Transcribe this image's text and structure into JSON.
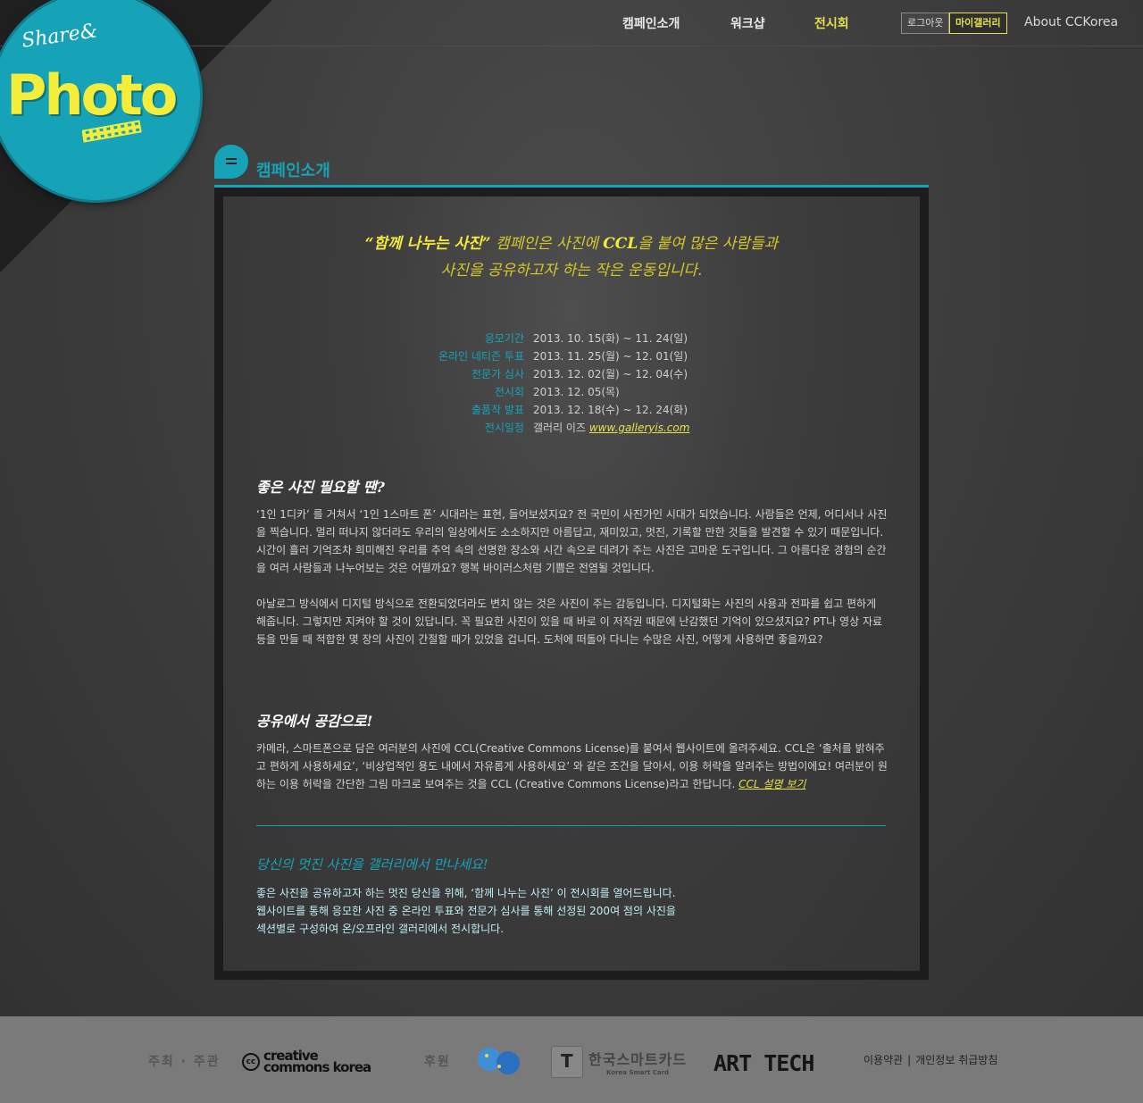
{
  "nav": {
    "items": [
      "캠페인소개",
      "워크샵",
      "전시회"
    ],
    "active_index": 2,
    "logout": "로그아웃",
    "mygallery": "마이갤러리",
    "about": "About CCKorea"
  },
  "logo": {
    "line1": "Share&",
    "line2": "Photo"
  },
  "section": {
    "title": "캠페인소개"
  },
  "slogan": {
    "highlight": "“함께 나누는 사진”",
    "line1_rest": " 캠페인은 사진에 ",
    "ccl": "CCL",
    "line1_end": "을 붙여 많은 사람들과",
    "line2": "사진을 공유하고자 하는 작은 운동입니다."
  },
  "info": {
    "rows": [
      {
        "label": "응모기간",
        "value": "2013. 10. 15(화) ~ 11. 24(일)"
      },
      {
        "label": "온라인 네티즌 투표",
        "value": "2013. 11. 25(월) ~ 12. 01(일)"
      },
      {
        "label": "전문가 심사",
        "value": "2013. 12. 02(월) ~ 12. 04(수)"
      },
      {
        "label": "전시회",
        "value": "2013. 12. 05(목)"
      },
      {
        "label": "출품작 발표",
        "value": "2013. 12. 18(수) ~ 12. 24(화)"
      },
      {
        "label": "전시일정",
        "value": "갤러리 이즈 ",
        "link": "www.galleryis.com"
      }
    ]
  },
  "section1": {
    "title": "좋은 사진 필요할 땐?",
    "p1": "‘1인 1디카’ 를 거쳐서 ‘1인 1스마트 폰’ 시대라는 표현, 들어보셨지요? 전 국민이 사진가인 시대가 되었습니다. 사람들은 언제, 어디서나 사진을 찍습니다. 멀리 떠나지 않더라도 우리의 일상에서도 소소하지만 아름답고, 재미있고, 멋진, 기록할 만한 것들을 발견할 수 있기 때문입니다. 시간이 흘러 기억조차 희미해진 우리를 추억 속의 선명한 장소와 시간 속으로 데려가 주는 사진은 고마운 도구입니다. 그 아름다운 경험의 순간을 여러 사람들과 나누어보는 것은 어떨까요? 행복 바이러스처럼 기쁨은 전염될 것입니다.",
    "p2": "아날로그 방식에서 디지털 방식으로 전환되었더라도 변치 않는 것은 사진이 주는 감동입니다. 디지털화는 사진의 사용과 전파를 쉽고 편하게 해줍니다. 그렇지만 지켜야 할 것이 있답니다. 꼭 필요한 사진이 있을 때 바로 이 저작권 때문에 난감했던 기억이 있으셨지요? PT나 영상 자료 등을 만들 때 적합한 몇 장의 사진이 간절할 때가 있었을 겁니다. 도처에 떠돌아 다니는 수많은 사진, 어떻게 사용하면 좋을까요?"
  },
  "section2": {
    "title": "공유에서 공감으로!",
    "p": "카메라, 스마트폰으로 담은 여러분의 사진에 CCL(Creative Commons License)를 붙여서 웹사이트에 올려주세요. CCL은 ‘출처를 밝혀주고 편하게 사용하세요’, ‘비상업적인 용도 내에서 자유롭게 사용하세요’ 와 같은 조건을 달아서, 이용 허락을 알려주는 방법이에요! 여러분이 원하는 이용 허락을 간단한 그림 마크로 보여주는 것을 CCL (Creative Commons License)라고 한답니다. ",
    "link": "CCL 설명 보기"
  },
  "section3": {
    "title": "당신의 멋진 사진을 갤러리에서 만나세요!",
    "line1": "좋은 사진을 공유하고자 하는 멋진 당신을 위해, ‘함께 나누는 사진’ 이 전시회를 열어드립니다.",
    "line2": "웹사이트를 통해 응모한 사진 중 온라인 투표와 전문가 심사를 통해 선정된 200여 점의 사진을",
    "line3": "섹션별로 구성하여 온/오프라인 갤러리에서 전시합니다."
  },
  "footer": {
    "host_label": "주최 · 주관",
    "cc_mark": "cc",
    "cc_line1": "creative",
    "cc_line2": "commons korea",
    "sponsor_label": "후원",
    "tmoney_label": "한국스마트카드",
    "tmoney_sub": "Korea Smart Card",
    "arttech": "ART TECH",
    "terms": "이용약관",
    "privacy": "개인정보 취급방침"
  },
  "colors": {
    "accent": "#17a3b7",
    "highlight": "#e6e14a",
    "background": "#3a3a3a"
  }
}
